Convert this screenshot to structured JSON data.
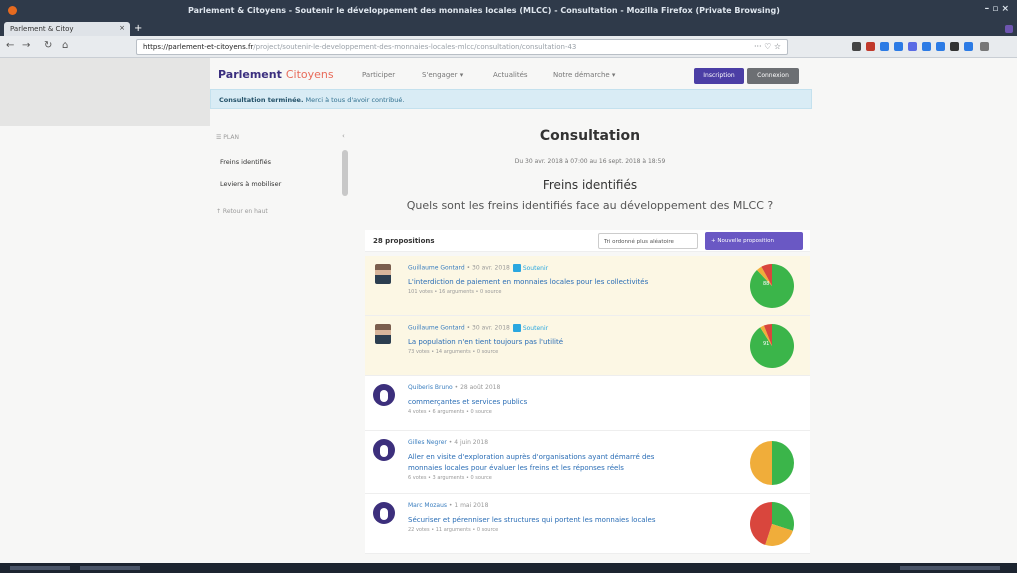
{
  "window": {
    "title": "Parlement & Citoyens - Soutenir le développement des monnaies locales (MLCC) - Consultation - Mozilla Firefox (Private Browsing)",
    "tab_label": "Parlement & Citoy",
    "tab_close": "×",
    "new_tab": "+"
  },
  "browser": {
    "back": "←",
    "forward": "→",
    "reload": "↻",
    "home": "⌂",
    "url_host": "https://parlement-et-citoyens.fr",
    "url_path": "/project/soutenir-le-developpement-des-monnaies-locales-mlcc/consultation/consultation-43",
    "url_actions": "··· ♡ ☆"
  },
  "site": {
    "brand_1": "Parlement",
    "brand_2": "Citoyens",
    "nav": [
      "Participer",
      "S'engager ▾",
      "Actualités",
      "Notre démarche ▾"
    ],
    "signup": "Inscription",
    "login": "Connexion"
  },
  "alert": {
    "strong": "Consultation terminée.",
    "text": " Merci à tous d'avoir contribué."
  },
  "sidebar": {
    "plan": "☰ PLAN",
    "collapse": "‹",
    "items": [
      "Freins identifiés",
      "Leviers à mobiliser"
    ],
    "back": "↑ Retour en haut"
  },
  "consultation": {
    "heading": "Consultation",
    "dates": "Du 30 avr. 2018 à 07:00 au 16 sept. 2018 à 18:59",
    "step_title": "Freins identifiés",
    "question": "Quels sont les freins identifiés face au développement des MLCC ?"
  },
  "list": {
    "count": "28 propositions",
    "sort": "Tri ordonné plus aléatoire",
    "new_proposal": "+ Nouvelle proposition"
  },
  "proposals": [
    {
      "author": "Guillaume Gontard",
      "date": " • 30 avr. 2018",
      "badge_label": "Soutenir",
      "title": "L'interdiction de paiement en monnaies locales pour les collectivités",
      "title2": "",
      "meta": "101 votes • 16 arguments • 0 source",
      "avatar": "photo",
      "style": "hl",
      "votes": {
        "ok": 0.88,
        "mitige": 0.04,
        "pas_ok": 0.08
      },
      "pie_label": "88"
    },
    {
      "author": "Guillaume Gontard",
      "date": " • 30 avr. 2018",
      "badge_label": "Soutenir",
      "title": "La population n'en tient toujours pas l'utilité",
      "title2": "",
      "meta": "73 votes • 14 arguments • 0 source",
      "avatar": "photo",
      "style": "hl",
      "votes": {
        "ok": 0.91,
        "mitige": 0.03,
        "pas_ok": 0.06
      },
      "pie_label": "91"
    },
    {
      "author": "Quiberis Bruno",
      "date": " • 28 août 2018",
      "badge_label": "",
      "title": "commerçantes et services publics",
      "title2": "",
      "meta": "4 votes • 6 arguments • 0 source",
      "avatar": "gen",
      "style": "plain",
      "votes": null,
      "pie_label": ""
    },
    {
      "author": "Gilles Negrer",
      "date": " • 4 juin 2018",
      "badge_label": "",
      "title": "Aller en visite d'exploration auprès d'organisations ayant démarré des",
      "title2": "monnaies locales pour évaluer les freins et les réponses réels",
      "meta": "6 votes • 3 arguments • 0 source",
      "avatar": "gen",
      "style": "plain",
      "votes": {
        "ok": 0.5,
        "mitige": 0.5,
        "pas_ok": 0.0
      },
      "pie_label": ""
    },
    {
      "author": "Marc Mozaus",
      "date": " • 1 mai 2018",
      "badge_label": "",
      "title": "Sécuriser et pérenniser les structures qui portent les monnaies locales",
      "title2": "",
      "meta": "22 votes • 11 arguments • 0 source",
      "avatar": "gen",
      "style": "plain",
      "votes": {
        "ok": 0.3,
        "mitige": 0.25,
        "pas_ok": 0.45
      },
      "pie_label": ""
    }
  ],
  "colors": {
    "ok": "#3bb54a",
    "mitige": "#f0ad3a",
    "pas_ok": "#d9463d",
    "accent": "#4b3ea5"
  }
}
